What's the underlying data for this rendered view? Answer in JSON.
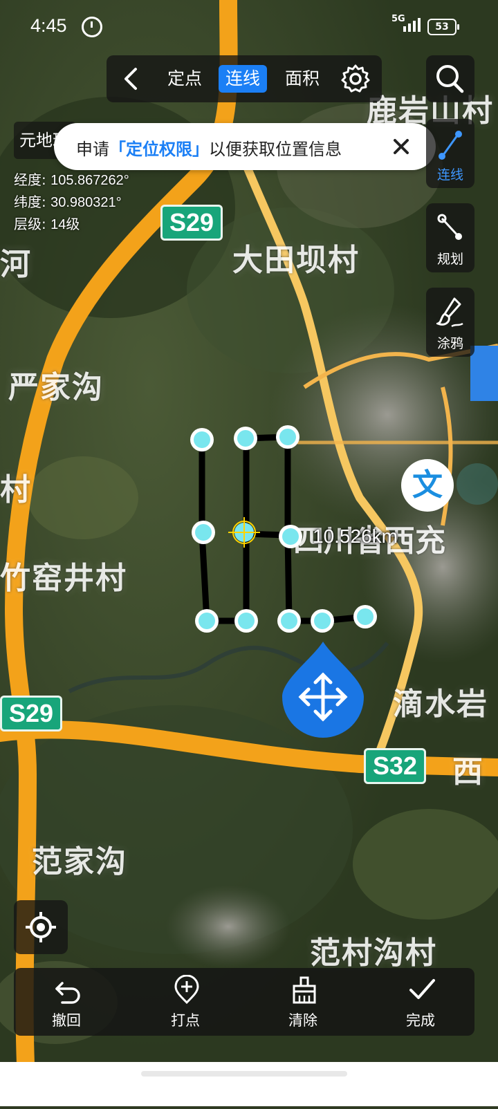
{
  "status_bar": {
    "time": "4:45",
    "network": "5G",
    "battery": "53"
  },
  "mode_bar": {
    "modes": [
      "定点",
      "连线",
      "面积"
    ],
    "active_mode": "连线"
  },
  "toast": {
    "prefix": "申请",
    "highlight": "「定位权限」",
    "suffix": "以便获取位置信息"
  },
  "info": {
    "app_name": "元地球",
    "longitude_label": "经度:",
    "longitude_value": "105.867262°",
    "latitude_label": "纬度:",
    "latitude_value": "30.980321°",
    "level_label": "层级:",
    "level_value": "14级"
  },
  "side_tools": [
    {
      "label": "连线",
      "icon": "line-tool-icon",
      "active": true
    },
    {
      "label": "规划",
      "icon": "route-plan-icon",
      "active": false
    },
    {
      "label": "涂鸦",
      "icon": "brush-icon",
      "active": false
    }
  ],
  "measurement": {
    "distance": "10.526km",
    "line_color": "#000000",
    "point_color": "#79e6ee",
    "cursor_color": "#ffd400"
  },
  "map_labels": {
    "place_1": "大田坝村",
    "place_2": "严家沟",
    "place_3": "竹窑井村",
    "place_4": "四川省西充",
    "place_5": "滴水岩",
    "place_6": "范家沟",
    "place_7": "范村沟村",
    "place_8": "鹿岩山村",
    "place_9": "河",
    "place_10": "村",
    "place_11": "西",
    "road_1": "S29",
    "road_2": "S29",
    "road_3": "S32"
  },
  "bottom_bar": {
    "undo": "撤回",
    "add_point": "打点",
    "clear": "清除",
    "done": "完成"
  },
  "colors": {
    "accent": "#1b7ff5",
    "road": "#f3a21a",
    "shield": "#18a57a"
  }
}
